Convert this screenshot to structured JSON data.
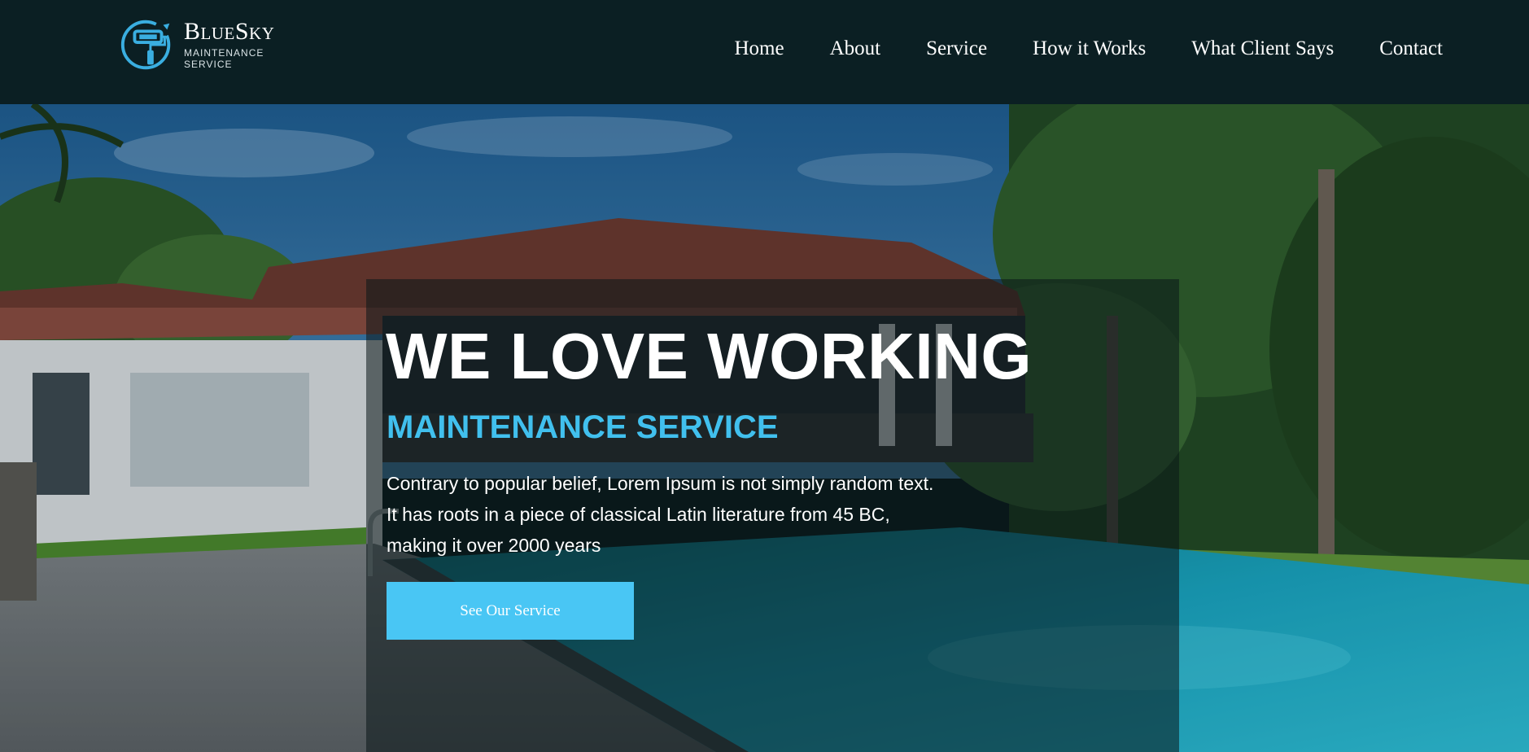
{
  "header": {
    "brand_name": "BlueSky",
    "brand_tagline": "MAINTENANCE SERVICE",
    "logo_icon": "paint-roller-icon",
    "nav": [
      {
        "label": "Home"
      },
      {
        "label": "About"
      },
      {
        "label": "Service"
      },
      {
        "label": "How it Works"
      },
      {
        "label": "What Client Says"
      },
      {
        "label": "Contact"
      }
    ]
  },
  "hero": {
    "headline": "WE LOVE WORKING",
    "subheadline": "MAINTENANCE SERVICE",
    "description_lines": [
      "Contrary to popular belief, Lorem Ipsum is not simply random text.",
      "It has roots in a piece of classical Latin literature from 45 BC,",
      "making it over 2000 years"
    ],
    "cta_label": "See Our Service"
  },
  "colors": {
    "header_bg": "#0b1f23",
    "accent": "#41c0ee",
    "button": "#49c6f4"
  }
}
